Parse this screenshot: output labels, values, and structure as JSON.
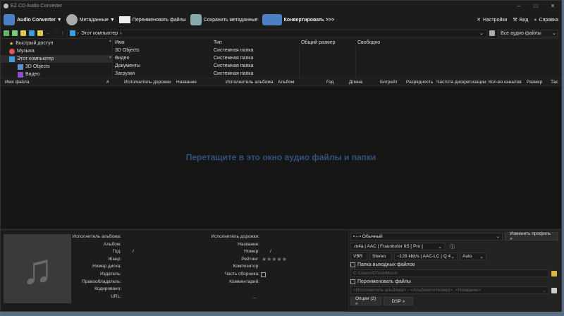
{
  "window": {
    "title": "EZ CD Audio Converter"
  },
  "toolbar": {
    "audio_converter": "Audio Converter ▼",
    "metadata": "Метаданные ▼",
    "rename": "Переименовать файлы",
    "save_meta": "Сохранить метаданные",
    "convert": "Конвертировать >>>",
    "settings": "Настройки",
    "view": "Вид",
    "help": "Справка"
  },
  "nav": {
    "path": "Этот компьютер",
    "filter": "Все аудио файлы"
  },
  "tree": [
    "Быстрый доступ",
    "Музыка",
    "Этот компьютер",
    "3D Objects",
    "Видео"
  ],
  "files": {
    "headers": [
      "Имя",
      "Тип",
      "Общий размер",
      "Свободно"
    ],
    "rows": [
      {
        "name": "3D Objects",
        "type": "Системная папка"
      },
      {
        "name": "Видео",
        "type": "Системная папка"
      },
      {
        "name": "Документы",
        "type": "Системная папка"
      },
      {
        "name": "Загрузки",
        "type": "Системная папка"
      }
    ]
  },
  "columns": [
    "Имя файла",
    "#",
    "Исполнитель дорожки",
    "Название",
    "Исполнитель альбома",
    "Альбом",
    "Год",
    "Длина",
    "Битрейт",
    "Разрядность",
    "Частота дискретизации",
    "Кол-во каналов",
    "Размер",
    "Тас"
  ],
  "drop_hint": "Перетащите в это окно аудио файлы и папки",
  "meta": {
    "left": [
      "Исполнитель альбома:",
      "Альбом:",
      "Год:",
      "Жанр:",
      "Номер диска:",
      "Издатель:",
      "Правообладатель:",
      "Кодировано:",
      "URL:"
    ],
    "right": [
      "Исполнитель дорожки:",
      "Название:",
      "Номер:",
      "Рейтинг:",
      "Композитор:",
      "Часть сборника:",
      "Комментарий:"
    ],
    "disc_sep": "/",
    "track_sep": "/",
    "rating": "★★★★★",
    "more": "..."
  },
  "profile": {
    "name": "Обычный",
    "change": "Изменить профиль »",
    "format": ".m4a | AAC | Fraunhofer IIS [ Pro ]",
    "mode": "VBR",
    "channels": "Stereo",
    "quality": "~128 kbit/s | AAC-LC | Q 4",
    "rate": "Auto",
    "out_folder_label": "Папка выходных файлов",
    "out_folder": "C:\\Users\\DTore\\Music",
    "rename_label": "Переименовать файлы",
    "rename_pattern": "<Исполнитель альбома> - <Альбом>\\<Номер>. <Название>",
    "options": "Опции (2) »",
    "dsp": "DSP »"
  }
}
